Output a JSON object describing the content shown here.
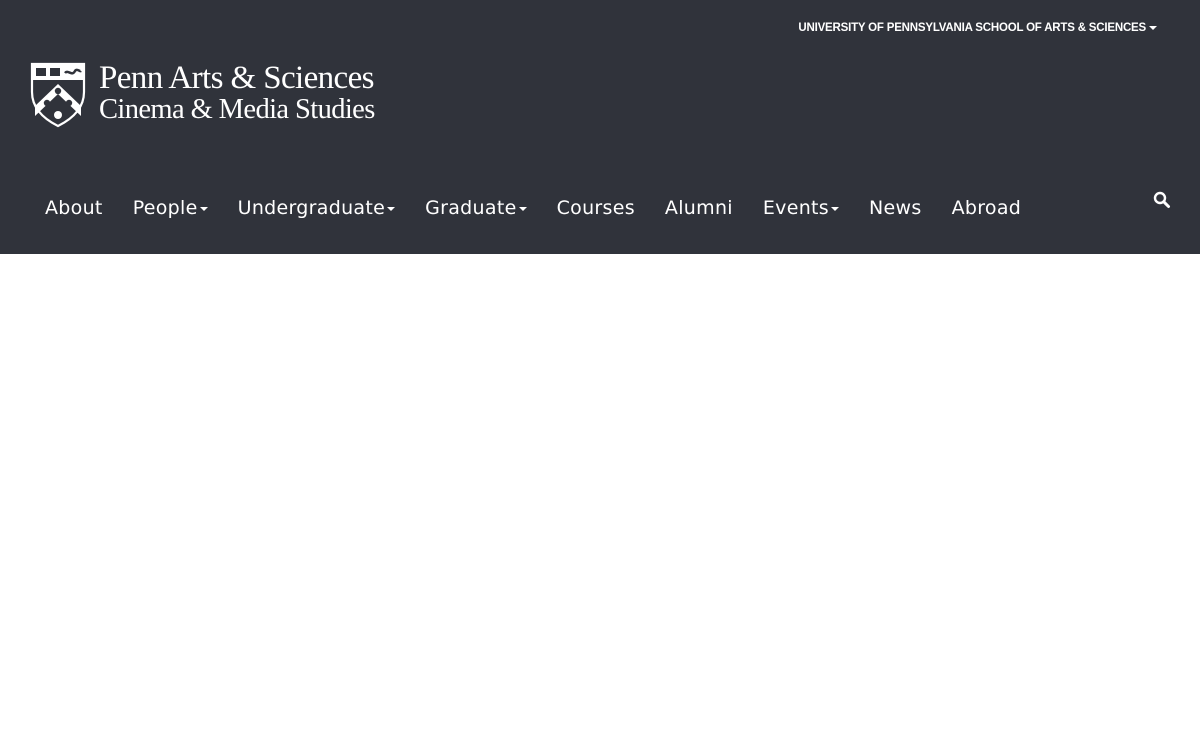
{
  "colors": {
    "header_bg": "#30333b",
    "text": "#ffffff",
    "page_bg": "#ffffff"
  },
  "utility_nav": {
    "label": "UNIVERSITY OF PENNSYLVANIA SCHOOL OF ARTS & SCIENCES",
    "icon": "caret-down-icon"
  },
  "brand": {
    "line1": "Penn Arts & Sciences",
    "line2": "Cinema & Media Studies",
    "logo_icon": "penn-shield-icon"
  },
  "nav": {
    "items": [
      {
        "label": "About",
        "has_dropdown": false
      },
      {
        "label": "People",
        "has_dropdown": true
      },
      {
        "label": "Undergraduate",
        "has_dropdown": true
      },
      {
        "label": "Graduate",
        "has_dropdown": true
      },
      {
        "label": "Courses",
        "has_dropdown": false
      },
      {
        "label": "Alumni",
        "has_dropdown": false
      },
      {
        "label": "Events",
        "has_dropdown": true
      },
      {
        "label": "News",
        "has_dropdown": false
      },
      {
        "label": "Abroad",
        "has_dropdown": false
      }
    ]
  },
  "search": {
    "icon": "search-icon"
  }
}
